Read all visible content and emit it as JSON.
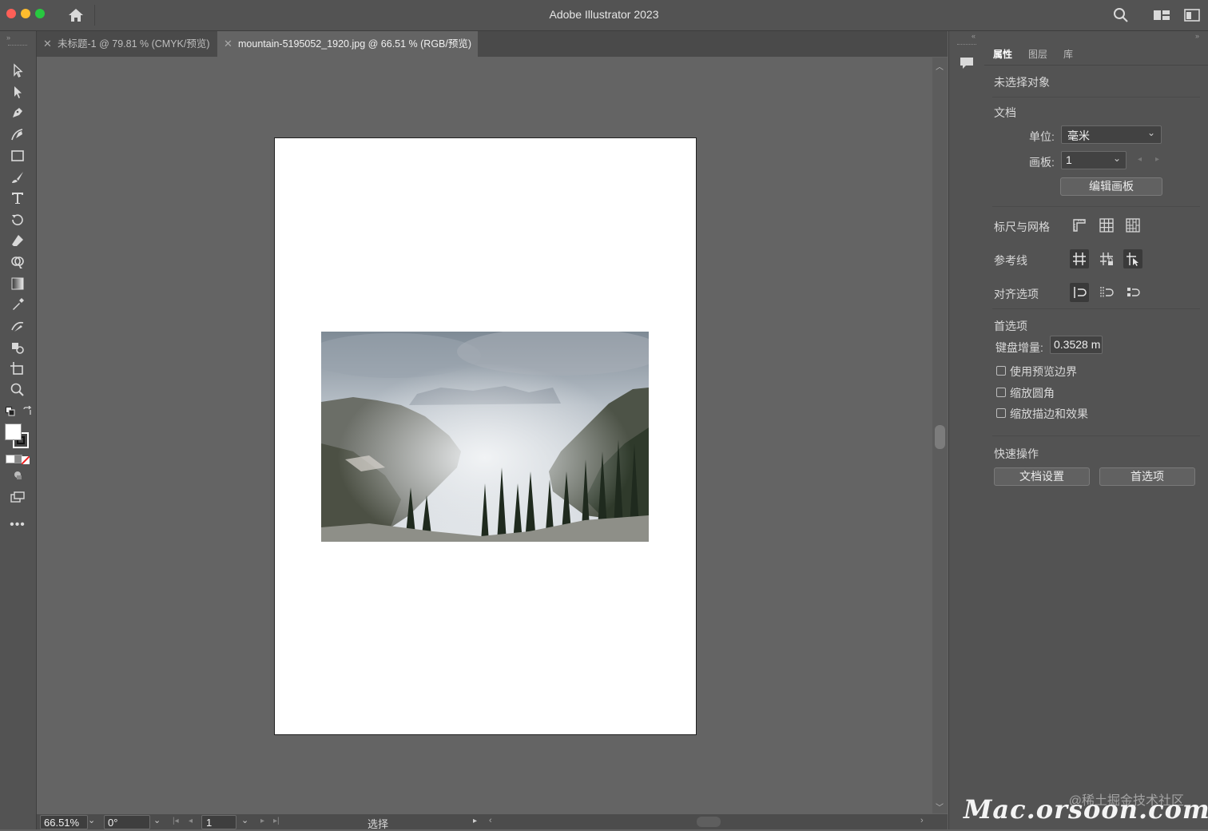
{
  "window": {
    "title": "Adobe Illustrator 2023"
  },
  "tabs": [
    {
      "label": "未标题-1 @ 79.81 % (CMYK/预览)",
      "active": false
    },
    {
      "label": "mountain-5195052_1920.jpg @ 66.51 % (RGB/预览)",
      "active": true
    }
  ],
  "status": {
    "zoom": "66.51%",
    "rotation": "0°",
    "artboard": "1",
    "tool": "选择"
  },
  "panel": {
    "tabs": [
      "属性",
      "图层",
      "库"
    ],
    "no_selection": "未选择对象",
    "document_section": "文档",
    "units_label": "单位:",
    "units_value": "毫米",
    "artboard_label": "画板:",
    "artboard_value": "1",
    "edit_artboard_button": "编辑画板",
    "rulers_grids_label": "标尺与网格",
    "guides_label": "参考线",
    "align_options_label": "对齐选项",
    "preferences_section": "首选项",
    "keyboard_increment_label": "键盘增量:",
    "keyboard_increment_value": "0.3528 m",
    "use_preview_bounds": "使用预览边界",
    "scale_corners": "缩放圆角",
    "scale_strokes_effects": "缩放描边和效果",
    "quick_actions_section": "快速操作",
    "document_setup_button": "文档设置",
    "preferences_button": "首选项"
  },
  "watermarks": {
    "juejin": "@稀土掘金技术社区",
    "site": "Mac.orsoon.com"
  },
  "colors": {
    "close": "#fe5f57",
    "minimize": "#febc2e",
    "maximize": "#28c840"
  }
}
